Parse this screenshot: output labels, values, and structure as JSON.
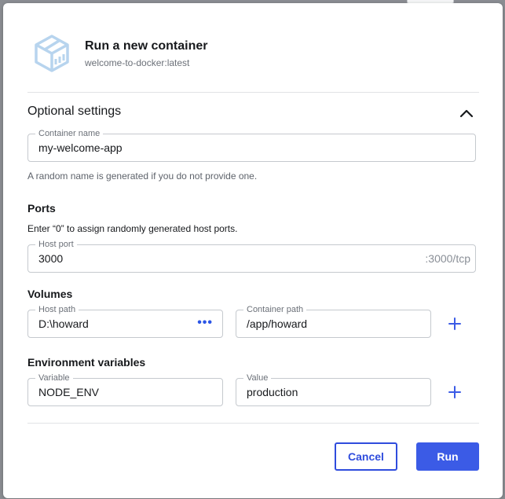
{
  "dialog": {
    "title": "Run a new container",
    "subtitle": "welcome-to-docker:latest",
    "logo_icon": "container-cube-icon"
  },
  "optional_settings": {
    "title": "Optional settings",
    "collapse_icon": "chevron-up-icon",
    "container_name": {
      "label": "Container name",
      "value": "my-welcome-app",
      "hint": "A random name is generated if you do not provide one."
    }
  },
  "ports": {
    "title": "Ports",
    "hint": "Enter “0” to assign randomly generated host ports.",
    "host_port": {
      "label": "Host port",
      "value": "3000",
      "suffix": ":3000/tcp"
    }
  },
  "volumes": {
    "title": "Volumes",
    "host_path": {
      "label": "Host path",
      "value": "D:\\howard",
      "browse_icon": "more-horizontal-icon"
    },
    "container_path": {
      "label": "Container path",
      "value": "/app/howard"
    },
    "add_icon": "plus-icon"
  },
  "env": {
    "title": "Environment variables",
    "variable": {
      "label": "Variable",
      "value": "NODE_ENV"
    },
    "value": {
      "label": "Value",
      "value": "production"
    },
    "add_icon": "plus-icon"
  },
  "actions": {
    "cancel_label": "Cancel",
    "run_label": "Run"
  },
  "colors": {
    "accent": "#3b5be6",
    "logo": "#b7d4ee"
  }
}
